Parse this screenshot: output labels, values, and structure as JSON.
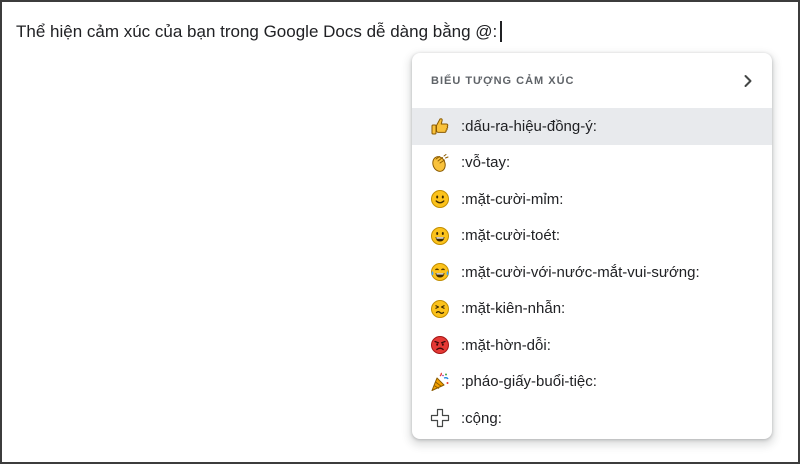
{
  "document": {
    "text": "Thể hiện cảm xúc của bạn trong Google Docs dễ dàng bằng @:"
  },
  "emoji_popup": {
    "title": "BIỂU TƯỢNG CẢM XÚC",
    "items": [
      {
        "label": ":dấu-ra-hiệu-đồng-ý:",
        "icon": "thumbs-up-icon",
        "selected": true
      },
      {
        "label": ":vỗ-tay:",
        "icon": "clapping-hands-icon"
      },
      {
        "label": ":mặt-cười-mỉm:",
        "icon": "slightly-smiling-face-icon"
      },
      {
        "label": ":mặt-cười-toét:",
        "icon": "grinning-face-icon"
      },
      {
        "label": ":mặt-cười-với-nước-mắt-vui-sướng:",
        "icon": "face-with-tears-of-joy-icon"
      },
      {
        "label": ":mặt-kiên-nhẫn:",
        "icon": "persevering-face-icon"
      },
      {
        "label": ":mặt-hờn-dỗi:",
        "icon": "pouting-face-icon"
      },
      {
        "label": ":pháo-giấy-buổi-tiệc:",
        "icon": "party-popper-icon"
      },
      {
        "label": ":cộng:",
        "icon": "plus-icon"
      }
    ]
  }
}
